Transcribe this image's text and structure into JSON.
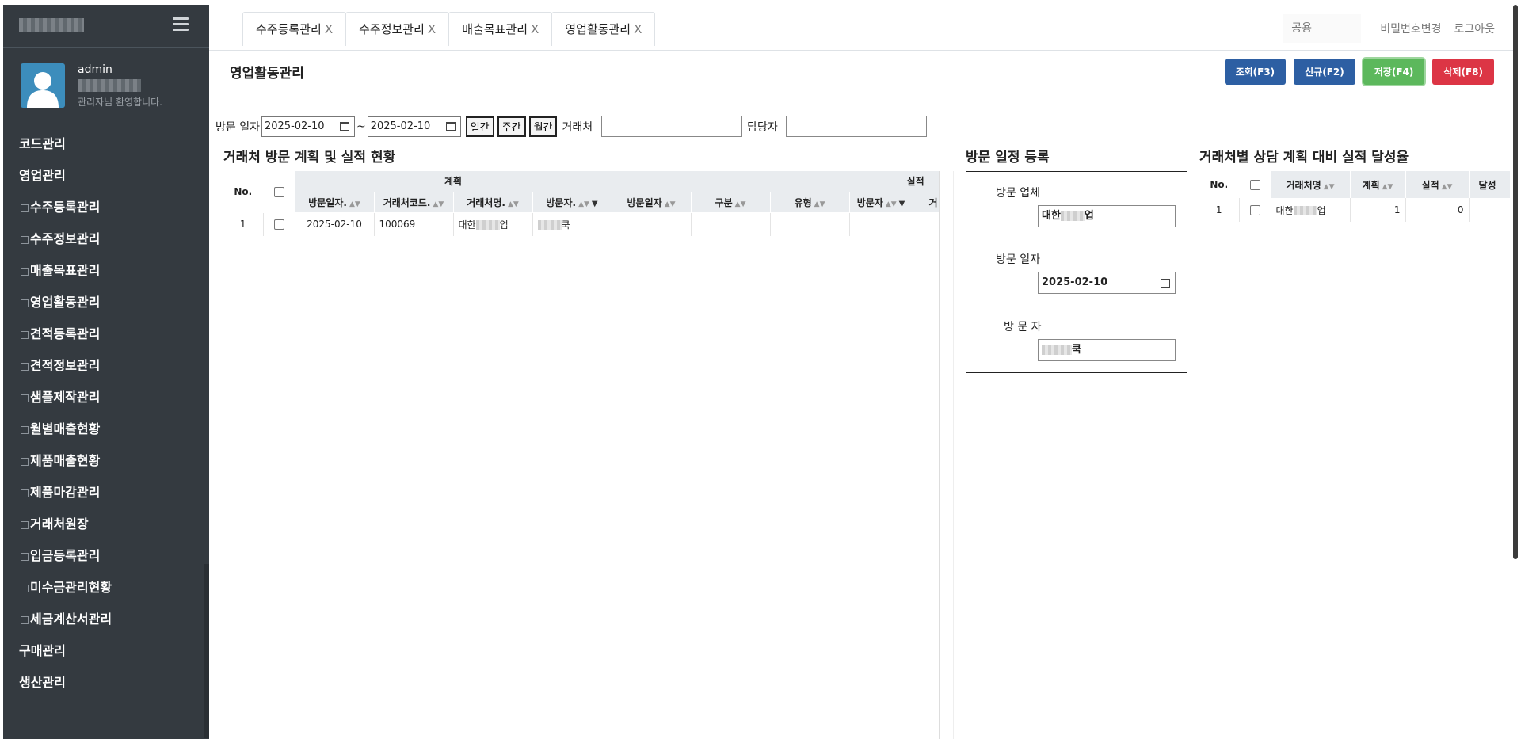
{
  "sidebar": {
    "user": {
      "name": "admin",
      "welcome": "관리자님 환영합니다."
    },
    "menu": [
      {
        "label": "코드관리",
        "sub": false
      },
      {
        "label": "영업관리",
        "sub": false
      },
      {
        "label": "수주등록관리",
        "sub": true
      },
      {
        "label": "수주정보관리",
        "sub": true
      },
      {
        "label": "매출목표관리",
        "sub": true
      },
      {
        "label": "영업활동관리",
        "sub": true
      },
      {
        "label": "견적등록관리",
        "sub": true
      },
      {
        "label": "견적정보관리",
        "sub": true
      },
      {
        "label": "샘플제작관리",
        "sub": true
      },
      {
        "label": "월별매출현황",
        "sub": true
      },
      {
        "label": "제품매출현황",
        "sub": true
      },
      {
        "label": "제품마감관리",
        "sub": true
      },
      {
        "label": "거래처원장",
        "sub": true
      },
      {
        "label": "입금등록관리",
        "sub": true
      },
      {
        "label": "미수금관리현황",
        "sub": true
      },
      {
        "label": "세금계산서관리",
        "sub": true
      },
      {
        "label": "구매관리",
        "sub": false
      },
      {
        "label": "생산관리",
        "sub": false
      }
    ]
  },
  "topbar": {
    "tabs": [
      {
        "label": "수주등록관리",
        "close": "X"
      },
      {
        "label": "수주정보관리",
        "close": "X"
      },
      {
        "label": "매출목표관리",
        "close": "X"
      },
      {
        "label": "영업활동관리",
        "close": "X"
      }
    ],
    "shared_placeholder": "공용",
    "change_password": "비밀번호변경",
    "logout": "로그아웃"
  },
  "page": {
    "title": "영업활동관리",
    "buttons": {
      "search": "조회(F3)",
      "new": "신규(F2)",
      "save": "저장(F4)",
      "delete": "삭제(F8)"
    }
  },
  "filter": {
    "visit_date_label": "방문 일자",
    "date_from": "2025-02-10",
    "separator": "~",
    "date_to": "2025-02-10",
    "daily": "일간",
    "weekly": "주간",
    "monthly": "월간",
    "client_label": "거래처",
    "manager_label": "담당자"
  },
  "plan_grid": {
    "title": "거래처 방문 계획 및 실적 현황",
    "no_header": "No.",
    "group_plan": "계획",
    "group_actual": "실적",
    "plan_columns": [
      "방문일자.",
      "거래처코드.",
      "거래처명.",
      "방문자."
    ],
    "actual_columns": [
      "방문일자",
      "구분",
      "유형",
      "방문자",
      "거"
    ],
    "rows": [
      {
        "no": "1",
        "visit_date": "2025-02-10",
        "client_code": "100069",
        "client_name_prefix": "대한",
        "client_name_suffix": "업",
        "visitor_suffix": "쿡"
      }
    ]
  },
  "visit_form": {
    "title": "방문 일정 등록",
    "company_label": "방문 업체",
    "company_prefix": "대한",
    "company_suffix": "업",
    "date_label": "방문 일자",
    "date_value": "2025-02-10",
    "visitor_label": "방 문 자",
    "visitor_suffix": "쿡"
  },
  "rate_grid": {
    "title": "거래처별 상담 계획 대비 실적 달성율",
    "columns": [
      "No.",
      "거래처명",
      "계획",
      "실적",
      "달성"
    ],
    "rows": [
      {
        "no": "1",
        "client_prefix": "대한",
        "client_suffix": "업",
        "plan": "1",
        "actual": "0"
      }
    ]
  },
  "colors": {
    "sidebar_bg": "#343a40",
    "btn_blue": "#2d5fa3",
    "btn_green": "#5cb85c",
    "btn_red": "#dc3545",
    "grid_header": "#e9ecef"
  }
}
